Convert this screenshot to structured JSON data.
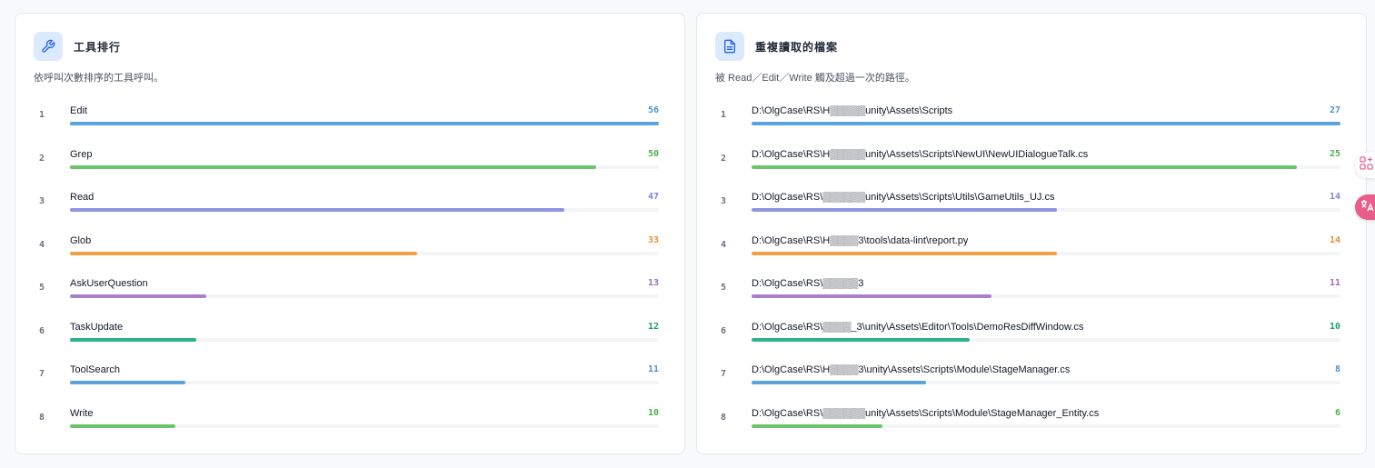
{
  "colors": [
    "#5aa3dc",
    "#6cc46a",
    "#8f94e0",
    "#f0a048",
    "#a880c8",
    "#2eb38e",
    "#5aa3dc",
    "#6cc46a"
  ],
  "value_colors": [
    "#4a93cf",
    "#4bb04a",
    "#7f85d6",
    "#e8902f",
    "#9a6fbf",
    "#1a9e78",
    "#4a93cf",
    "#4bb04a"
  ],
  "tools": {
    "icon": "wrench-icon",
    "title": "工具排行",
    "subtitle": "依呼叫次數排序的工具呼叫。",
    "max": 56,
    "rows": [
      {
        "rank": "1",
        "label": "Edit",
        "value": 56
      },
      {
        "rank": "2",
        "label": "Grep",
        "value": 50
      },
      {
        "rank": "3",
        "label": "Read",
        "value": 47
      },
      {
        "rank": "4",
        "label": "Glob",
        "value": 33
      },
      {
        "rank": "5",
        "label": "AskUserQuestion",
        "value": 13
      },
      {
        "rank": "6",
        "label": "TaskUpdate",
        "value": 12
      },
      {
        "rank": "7",
        "label": "ToolSearch",
        "value": 11
      },
      {
        "rank": "8",
        "label": "Write",
        "value": 10
      }
    ]
  },
  "files": {
    "icon": "document-icon",
    "title": "重複讀取的檔案",
    "subtitle": "被 Read／Edit／Write 觸及超過一次的路徑。",
    "max": 27,
    "rows": [
      {
        "rank": "1",
        "label": "D:\\OlgCase\\RS\\H▒▒▒▒▒unity\\Assets\\Scripts",
        "value": 27
      },
      {
        "rank": "2",
        "label": "D:\\OlgCase\\RS\\H▒▒▒▒▒unity\\Assets\\Scripts\\NewUI\\NewUIDialogueTalk.cs",
        "value": 25
      },
      {
        "rank": "3",
        "label": "D:\\OlgCase\\RS\\▒▒▒▒▒▒unity\\Assets\\Scripts\\Utils\\GameUtils_UJ.cs",
        "value": 14
      },
      {
        "rank": "4",
        "label": "D:\\OlgCase\\RS\\H▒▒▒▒3\\tools\\data-lint\\report.py",
        "value": 14
      },
      {
        "rank": "5",
        "label": "D:\\OlgCase\\RS\\▒▒▒▒▒3",
        "value": 11
      },
      {
        "rank": "6",
        "label": "D:\\OlgCase\\RS\\▒▒▒▒_3\\unity\\Assets\\Editor\\Tools\\DemoResDiffWindow.cs",
        "value": 10
      },
      {
        "rank": "7",
        "label": "D:\\OlgCase\\RS\\H▒▒▒▒3\\unity\\Assets\\Scripts\\Module\\StageManager.cs",
        "value": 8
      },
      {
        "rank": "8",
        "label": "D:\\OlgCase\\RS\\▒▒▒▒▒▒unity\\Assets\\Scripts\\Module\\StageManager_Entity.cs",
        "value": 6
      }
    ]
  },
  "side_buttons": [
    "apps-icon",
    "translate-icon"
  ]
}
